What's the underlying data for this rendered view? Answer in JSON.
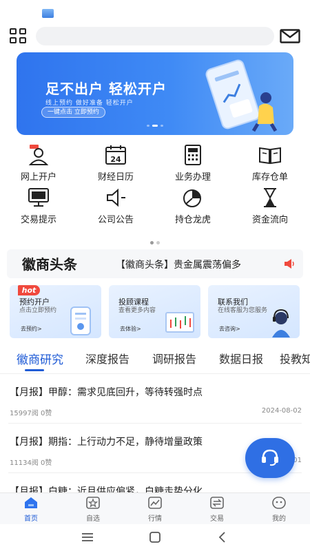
{
  "header": {
    "search_placeholder": ""
  },
  "banner": {
    "title": "足不出户 轻松开户",
    "subtitle": "线上预约  做好准备  轻松开户",
    "button": "一键点击 立即预约"
  },
  "menu": [
    {
      "label": "网上开户",
      "icon": "account-open-icon"
    },
    {
      "label": "财经日历",
      "icon": "calendar-icon"
    },
    {
      "label": "业务办理",
      "icon": "calculator-icon"
    },
    {
      "label": "库存仓单",
      "icon": "book-icon"
    },
    {
      "label": "交易提示",
      "icon": "monitor-icon"
    },
    {
      "label": "公司公告",
      "icon": "speaker-icon"
    },
    {
      "label": "持仓龙虎",
      "icon": "pie-chart-icon"
    },
    {
      "label": "资金流向",
      "icon": "hourglass-icon"
    }
  ],
  "news": {
    "logo_text": "徽商头条",
    "headline": "【徽商头条】贵金属震荡偏多"
  },
  "cards": [
    {
      "badge": "hot",
      "title": "预约开户",
      "subtitle": "点击立即预约",
      "link": "去预约>"
    },
    {
      "title": "投顾课程",
      "subtitle": "查看更多内容",
      "link": "去体验>"
    },
    {
      "title": "联系我们",
      "subtitle": "在线客服为您服务",
      "link": "去咨询>"
    }
  ],
  "tabs": [
    "徽商研究",
    "深度报告",
    "调研报告",
    "数据日报",
    "投教知"
  ],
  "articles": [
    {
      "title": "【月报】甲醇：需求见底回升，等待转强时点",
      "reads": "15997阅",
      "likes": "0赞",
      "date": "2024-08-02"
    },
    {
      "title": "【月报】期指：上行动力不足，静待增量政策",
      "reads": "11134阅",
      "likes": "0赞",
      "date": "2024-08-01"
    },
    {
      "title": "【月报】白糖：近月供应偏紧，白糖走势分化",
      "reads": "",
      "likes": "",
      "date": ""
    }
  ],
  "bottom_nav": [
    "首页",
    "自选",
    "行情",
    "交易",
    "我的"
  ],
  "colors": {
    "accent": "#1f5bd6",
    "banner": "#2f74ee",
    "hot": "#f0493d"
  }
}
